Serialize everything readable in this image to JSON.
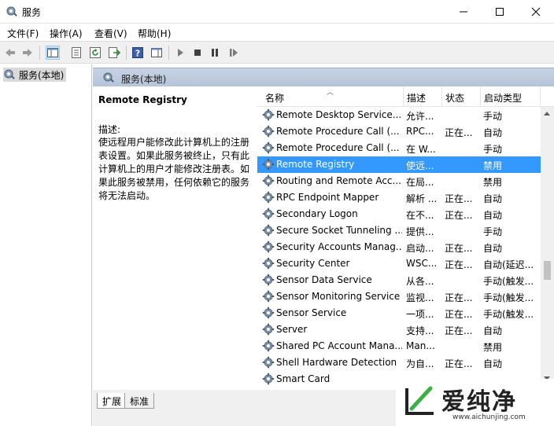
{
  "window": {
    "title": "服务"
  },
  "menu": [
    "文件(F)",
    "操作(A)",
    "查看(V)",
    "帮助(H)"
  ],
  "toolbar_icons": [
    "back-arrow-icon",
    "forward-arrow-icon",
    "show-hide-tree-icon",
    "properties-icon",
    "refresh-icon",
    "export-list-icon",
    "help-icon",
    "action-pane-icon",
    "play-icon",
    "stop-icon",
    "pause-icon",
    "restart-icon"
  ],
  "tree": {
    "root_label": "服务(本地)"
  },
  "pane": {
    "header": "服务(本地)"
  },
  "detail": {
    "service_name": "Remote Registry",
    "desc_label": "描述:",
    "desc_text": "使远程用户能修改此计算机上的注册表设置。如果此服务被终止，只有此计算机上的用户才能修改注册表。如果此服务被禁用，任何依赖它的服务将无法启动。"
  },
  "columns": [
    "名称",
    "描述",
    "状态",
    "启动类型"
  ],
  "services": [
    {
      "name": "Remote Desktop Service...",
      "desc": "允许...",
      "status": "",
      "startup": "手动"
    },
    {
      "name": "Remote Procedure Call (...",
      "desc": "RPC...",
      "status": "正在...",
      "startup": "自动"
    },
    {
      "name": "Remote Procedure Call (...",
      "desc": "在 W...",
      "status": "",
      "startup": "手动"
    },
    {
      "name": "Remote Registry",
      "desc": "使远...",
      "status": "",
      "startup": "禁用",
      "selected": true
    },
    {
      "name": "Routing and Remote Acc...",
      "desc": "在局...",
      "status": "",
      "startup": "禁用"
    },
    {
      "name": "RPC Endpoint Mapper",
      "desc": "解析 ...",
      "status": "正在...",
      "startup": "自动"
    },
    {
      "name": "Secondary Logon",
      "desc": "在不...",
      "status": "正在...",
      "startup": "自动"
    },
    {
      "name": "Secure Socket Tunneling ...",
      "desc": "提供...",
      "status": "",
      "startup": "手动"
    },
    {
      "name": "Security Accounts Manag...",
      "desc": "启动...",
      "status": "正在...",
      "startup": "自动"
    },
    {
      "name": "Security Center",
      "desc": "WSC...",
      "status": "正在...",
      "startup": "自动(延迟..."
    },
    {
      "name": "Sensor Data Service",
      "desc": "从各...",
      "status": "",
      "startup": "手动(触发..."
    },
    {
      "name": "Sensor Monitoring Service",
      "desc": "监视...",
      "status": "正在...",
      "startup": "手动(触发..."
    },
    {
      "name": "Sensor Service",
      "desc": "一项...",
      "status": "正在...",
      "startup": "手动(触发..."
    },
    {
      "name": "Server",
      "desc": "支持...",
      "status": "正在...",
      "startup": "自动"
    },
    {
      "name": "Shared PC Account Mana...",
      "desc": "Man...",
      "status": "",
      "startup": "禁用"
    },
    {
      "name": "Shell Hardware Detection",
      "desc": "为自...",
      "status": "正在...",
      "startup": "自动"
    },
    {
      "name": "Smart Card",
      "desc": "",
      "status": "",
      "startup": ""
    }
  ],
  "tabs": [
    "扩展",
    "标准"
  ],
  "watermark": {
    "brand": "爱纯净",
    "url": "www.aichunjing.com"
  }
}
